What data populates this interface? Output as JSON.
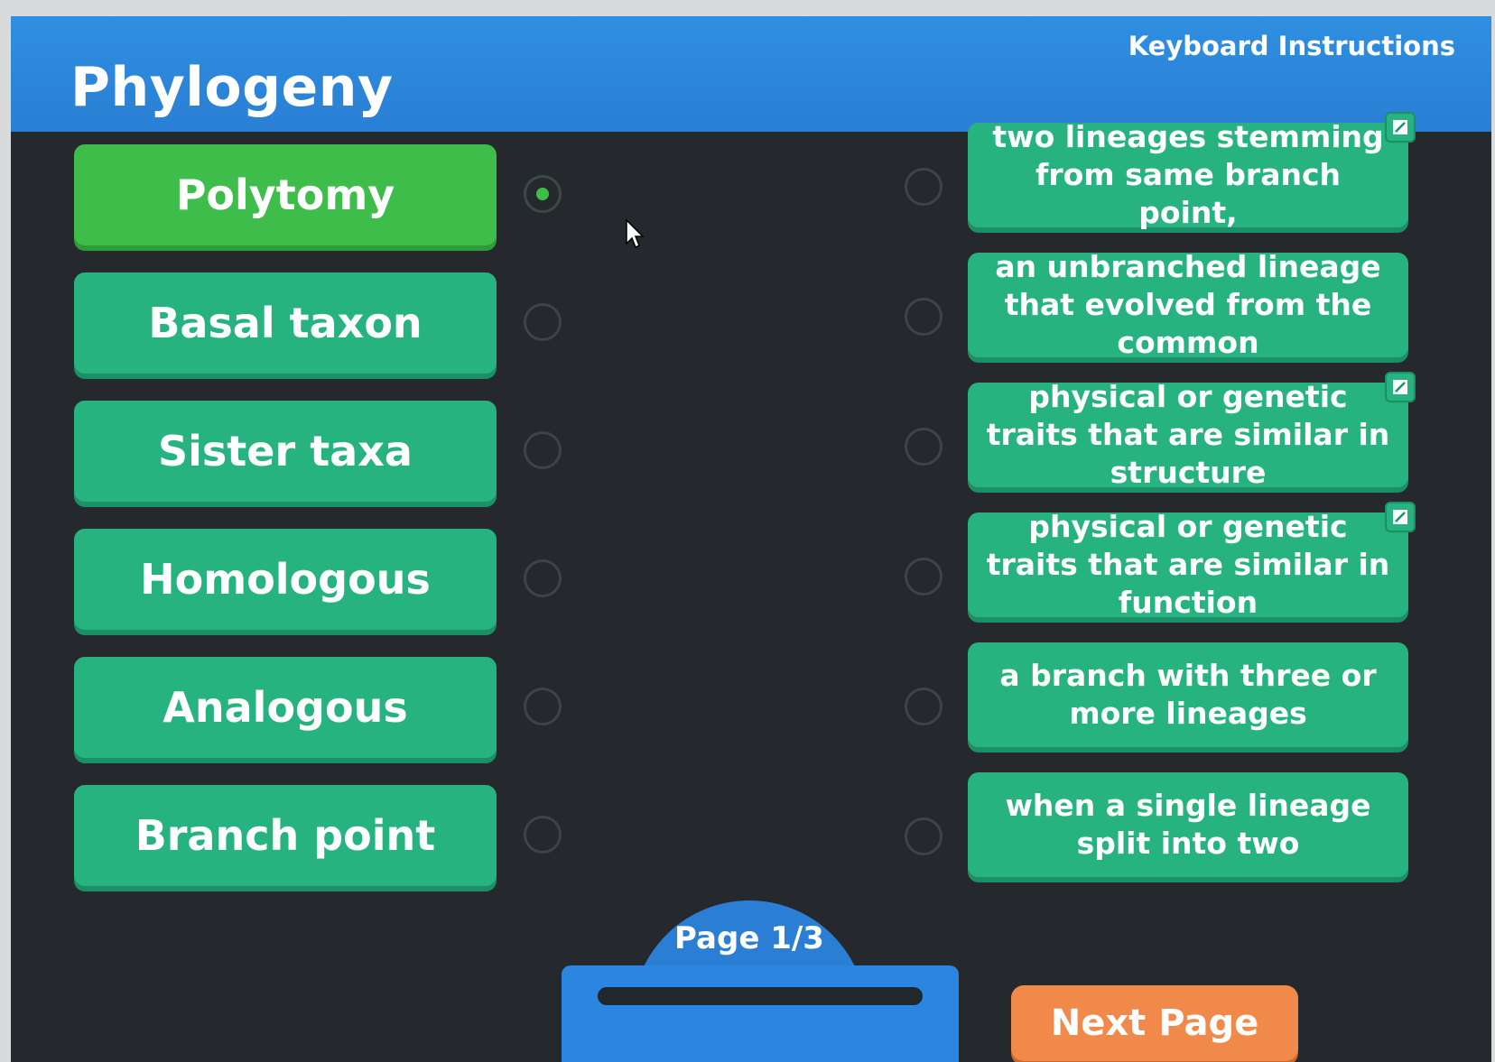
{
  "header": {
    "title": "Phylogeny",
    "keyboard_instructions": "Keyboard Instructions"
  },
  "terms": [
    {
      "label": "Polytomy",
      "selected": true
    },
    {
      "label": "Basal taxon",
      "selected": false
    },
    {
      "label": "Sister taxa",
      "selected": false
    },
    {
      "label": "Homologous",
      "selected": false
    },
    {
      "label": "Analogous",
      "selected": false
    },
    {
      "label": "Branch point",
      "selected": false
    }
  ],
  "definitions": [
    {
      "text": "two lineages stemming from same branch point,",
      "has_expand": true
    },
    {
      "text": "an unbranched lineage that evolved from the common",
      "has_expand": false
    },
    {
      "text": "physical or genetic traits that are similar in structure",
      "has_expand": true
    },
    {
      "text": "physical or genetic traits that are similar in function",
      "has_expand": true
    },
    {
      "text": "a branch with three or more lineages",
      "has_expand": false
    },
    {
      "text": "when a single lineage split into two",
      "has_expand": false
    }
  ],
  "pager": {
    "label": "Page 1/3"
  },
  "next_button": {
    "label": "Next Page"
  },
  "colors": {
    "header_blue": "#2f8fe0",
    "tile_green": "#27b380",
    "selected_green": "#3fbd4a",
    "background": "#25292d",
    "next_orange": "#f0894a"
  },
  "icons": [
    "expand-icon",
    "mouse-cursor-icon"
  ]
}
